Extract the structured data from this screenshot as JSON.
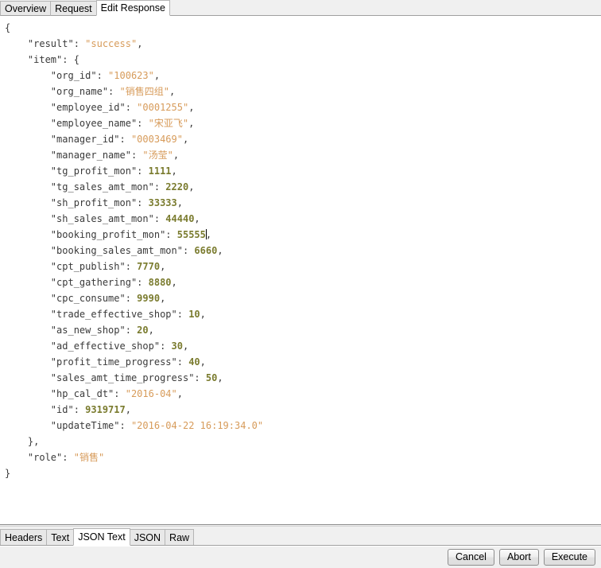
{
  "window": {
    "top_tabs": [
      {
        "label": "Overview",
        "active": false
      },
      {
        "label": "Request",
        "active": false
      },
      {
        "label": "Edit Response",
        "active": true
      }
    ]
  },
  "editor": {
    "language": "json",
    "caret_after_line_index": 13,
    "lines": [
      {
        "indent": 0,
        "tokens": [
          {
            "t": "punct",
            "v": "{"
          }
        ]
      },
      {
        "indent": 1,
        "tokens": [
          {
            "t": "key",
            "v": "\"result\""
          },
          {
            "t": "punct",
            "v": ": "
          },
          {
            "t": "strv",
            "v": "\"success\""
          },
          {
            "t": "punct",
            "v": ","
          }
        ]
      },
      {
        "indent": 1,
        "tokens": [
          {
            "t": "key",
            "v": "\"item\""
          },
          {
            "t": "punct",
            "v": ": {"
          }
        ]
      },
      {
        "indent": 2,
        "tokens": [
          {
            "t": "key",
            "v": "\"org_id\""
          },
          {
            "t": "punct",
            "v": ": "
          },
          {
            "t": "strv",
            "v": "\"100623\""
          },
          {
            "t": "punct",
            "v": ","
          }
        ]
      },
      {
        "indent": 2,
        "tokens": [
          {
            "t": "key",
            "v": "\"org_name\""
          },
          {
            "t": "punct",
            "v": ": "
          },
          {
            "t": "strv",
            "v": "\"销售四组\""
          },
          {
            "t": "punct",
            "v": ","
          }
        ]
      },
      {
        "indent": 2,
        "tokens": [
          {
            "t": "key",
            "v": "\"employee_id\""
          },
          {
            "t": "punct",
            "v": ": "
          },
          {
            "t": "strv",
            "v": "\"0001255\""
          },
          {
            "t": "punct",
            "v": ","
          }
        ]
      },
      {
        "indent": 2,
        "tokens": [
          {
            "t": "key",
            "v": "\"employee_name\""
          },
          {
            "t": "punct",
            "v": ": "
          },
          {
            "t": "strv",
            "v": "\"宋亚飞\""
          },
          {
            "t": "punct",
            "v": ","
          }
        ]
      },
      {
        "indent": 2,
        "tokens": [
          {
            "t": "key",
            "v": "\"manager_id\""
          },
          {
            "t": "punct",
            "v": ": "
          },
          {
            "t": "strv",
            "v": "\"0003469\""
          },
          {
            "t": "punct",
            "v": ","
          }
        ]
      },
      {
        "indent": 2,
        "tokens": [
          {
            "t": "key",
            "v": "\"manager_name\""
          },
          {
            "t": "punct",
            "v": ": "
          },
          {
            "t": "strv",
            "v": "\"汤莹\""
          },
          {
            "t": "punct",
            "v": ","
          }
        ]
      },
      {
        "indent": 2,
        "tokens": [
          {
            "t": "key",
            "v": "\"tg_profit_mon\""
          },
          {
            "t": "punct",
            "v": ": "
          },
          {
            "t": "numv",
            "v": "1111"
          },
          {
            "t": "punct",
            "v": ","
          }
        ]
      },
      {
        "indent": 2,
        "tokens": [
          {
            "t": "key",
            "v": "\"tg_sales_amt_mon\""
          },
          {
            "t": "punct",
            "v": ": "
          },
          {
            "t": "numv",
            "v": "2220"
          },
          {
            "t": "punct",
            "v": ","
          }
        ]
      },
      {
        "indent": 2,
        "tokens": [
          {
            "t": "key",
            "v": "\"sh_profit_mon\""
          },
          {
            "t": "punct",
            "v": ": "
          },
          {
            "t": "numv",
            "v": "33333"
          },
          {
            "t": "punct",
            "v": ","
          }
        ]
      },
      {
        "indent": 2,
        "tokens": [
          {
            "t": "key",
            "v": "\"sh_sales_amt_mon\""
          },
          {
            "t": "punct",
            "v": ": "
          },
          {
            "t": "numv",
            "v": "44440"
          },
          {
            "t": "punct",
            "v": ","
          }
        ]
      },
      {
        "indent": 2,
        "tokens": [
          {
            "t": "key",
            "v": "\"booking_profit_mon\""
          },
          {
            "t": "punct",
            "v": ": "
          },
          {
            "t": "numv",
            "v": "55555"
          },
          {
            "t": "caret",
            "v": ""
          },
          {
            "t": "punct",
            "v": ","
          }
        ]
      },
      {
        "indent": 2,
        "tokens": [
          {
            "t": "key",
            "v": "\"booking_sales_amt_mon\""
          },
          {
            "t": "punct",
            "v": ": "
          },
          {
            "t": "numv",
            "v": "6660"
          },
          {
            "t": "punct",
            "v": ","
          }
        ]
      },
      {
        "indent": 2,
        "tokens": [
          {
            "t": "key",
            "v": "\"cpt_publish\""
          },
          {
            "t": "punct",
            "v": ": "
          },
          {
            "t": "numv",
            "v": "7770"
          },
          {
            "t": "punct",
            "v": ","
          }
        ]
      },
      {
        "indent": 2,
        "tokens": [
          {
            "t": "key",
            "v": "\"cpt_gathering\""
          },
          {
            "t": "punct",
            "v": ": "
          },
          {
            "t": "numv",
            "v": "8880"
          },
          {
            "t": "punct",
            "v": ","
          }
        ]
      },
      {
        "indent": 2,
        "tokens": [
          {
            "t": "key",
            "v": "\"cpc_consume\""
          },
          {
            "t": "punct",
            "v": ": "
          },
          {
            "t": "numv",
            "v": "9990"
          },
          {
            "t": "punct",
            "v": ","
          }
        ]
      },
      {
        "indent": 2,
        "tokens": [
          {
            "t": "key",
            "v": "\"trade_effective_shop\""
          },
          {
            "t": "punct",
            "v": ": "
          },
          {
            "t": "numv",
            "v": "10"
          },
          {
            "t": "punct",
            "v": ","
          }
        ]
      },
      {
        "indent": 2,
        "tokens": [
          {
            "t": "key",
            "v": "\"as_new_shop\""
          },
          {
            "t": "punct",
            "v": ": "
          },
          {
            "t": "numv",
            "v": "20"
          },
          {
            "t": "punct",
            "v": ","
          }
        ]
      },
      {
        "indent": 2,
        "tokens": [
          {
            "t": "key",
            "v": "\"ad_effective_shop\""
          },
          {
            "t": "punct",
            "v": ": "
          },
          {
            "t": "numv",
            "v": "30"
          },
          {
            "t": "punct",
            "v": ","
          }
        ]
      },
      {
        "indent": 2,
        "tokens": [
          {
            "t": "key",
            "v": "\"profit_time_progress\""
          },
          {
            "t": "punct",
            "v": ": "
          },
          {
            "t": "numv",
            "v": "40"
          },
          {
            "t": "punct",
            "v": ","
          }
        ]
      },
      {
        "indent": 2,
        "tokens": [
          {
            "t": "key",
            "v": "\"sales_amt_time_progress\""
          },
          {
            "t": "punct",
            "v": ": "
          },
          {
            "t": "numv",
            "v": "50"
          },
          {
            "t": "punct",
            "v": ","
          }
        ]
      },
      {
        "indent": 2,
        "tokens": [
          {
            "t": "key",
            "v": "\"hp_cal_dt\""
          },
          {
            "t": "punct",
            "v": ": "
          },
          {
            "t": "strv",
            "v": "\"2016-04\""
          },
          {
            "t": "punct",
            "v": ","
          }
        ]
      },
      {
        "indent": 2,
        "tokens": [
          {
            "t": "key",
            "v": "\"id\""
          },
          {
            "t": "punct",
            "v": ": "
          },
          {
            "t": "numv",
            "v": "9319717"
          },
          {
            "t": "punct",
            "v": ","
          }
        ]
      },
      {
        "indent": 2,
        "tokens": [
          {
            "t": "key",
            "v": "\"updateTime\""
          },
          {
            "t": "punct",
            "v": ": "
          },
          {
            "t": "strv",
            "v": "\"2016-04-22 16:19:34.0\""
          }
        ]
      },
      {
        "indent": 1,
        "tokens": [
          {
            "t": "punct",
            "v": "},"
          }
        ]
      },
      {
        "indent": 1,
        "tokens": [
          {
            "t": "key",
            "v": "\"role\""
          },
          {
            "t": "punct",
            "v": ": "
          },
          {
            "t": "strv",
            "v": "\"销售\""
          }
        ]
      },
      {
        "indent": 0,
        "tokens": [
          {
            "t": "punct",
            "v": "}"
          }
        ]
      }
    ]
  },
  "bottom": {
    "tabs": [
      {
        "label": "Headers",
        "active": false
      },
      {
        "label": "Text",
        "active": false
      },
      {
        "label": "JSON Text",
        "active": true
      },
      {
        "label": "JSON",
        "active": false
      },
      {
        "label": "Raw",
        "active": false
      }
    ],
    "buttons": [
      {
        "label": "Cancel"
      },
      {
        "label": "Abort"
      },
      {
        "label": "Execute"
      }
    ]
  },
  "colors": {
    "string_value": "#d79b5a",
    "number_value": "#7a7b2e",
    "key": "#3a3a3a",
    "chrome": "#f0f0f0",
    "editor_background": "#ffffff"
  }
}
